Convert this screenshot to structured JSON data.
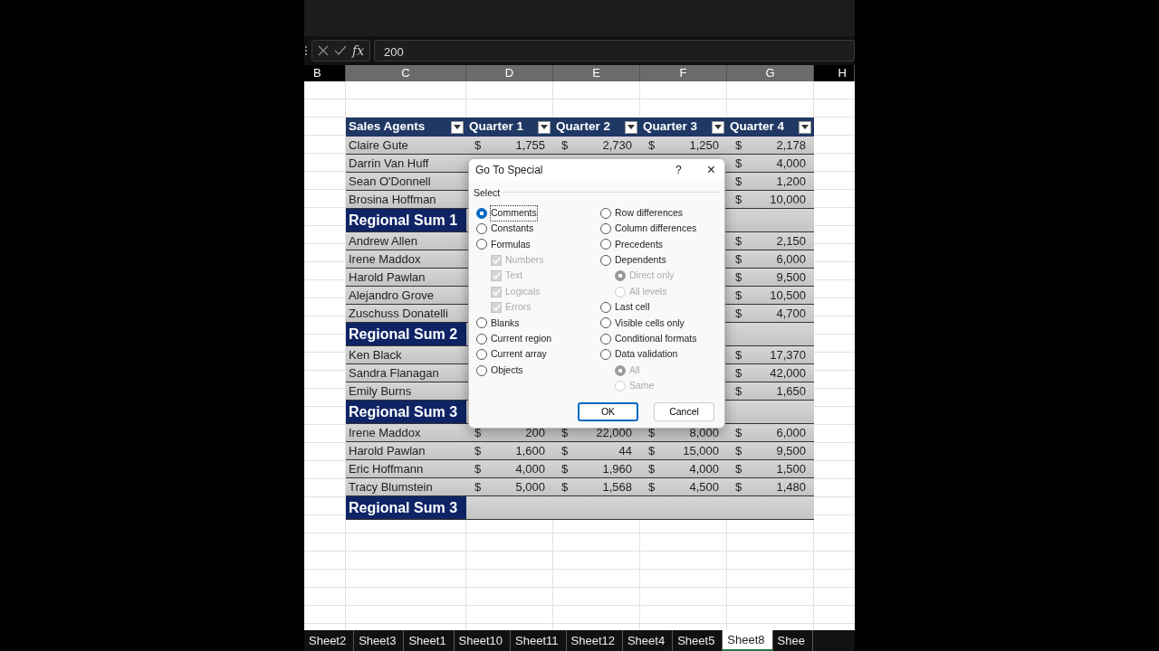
{
  "formula_bar": {
    "function_label": "fx",
    "value": "200"
  },
  "column_headers": [
    {
      "label": "B",
      "selected": false
    },
    {
      "label": "C",
      "selected": true
    },
    {
      "label": "D",
      "selected": true
    },
    {
      "label": "E",
      "selected": true
    },
    {
      "label": "F",
      "selected": true
    },
    {
      "label": "G",
      "selected": true
    },
    {
      "label": "H",
      "selected": false
    }
  ],
  "table": {
    "columns": [
      "Sales Agents",
      "Quarter 1",
      "Quarter 2",
      "Quarter 3",
      "Quarter 4"
    ],
    "rows": [
      {
        "kind": "data",
        "name": "Claire Gute",
        "values": [
          [
            "$",
            "1,755"
          ],
          [
            "$",
            "2,730"
          ],
          [
            "$",
            "1,250"
          ],
          [
            "$",
            "2,178"
          ]
        ]
      },
      {
        "kind": "data",
        "name": "Darrin Van Huff",
        "values": [
          [
            "$",
            "4,000"
          ]
        ]
      },
      {
        "kind": "data",
        "name": "Sean O'Donnell",
        "values": [
          [
            "$",
            "1,200"
          ]
        ]
      },
      {
        "kind": "data",
        "name": "Brosina Hoffman",
        "values": [
          [
            "$",
            "10,000"
          ]
        ]
      },
      {
        "kind": "sum",
        "name": "Regional Sum 1"
      },
      {
        "kind": "data",
        "name": "Andrew Allen",
        "values": [
          [
            "$",
            "2,150"
          ]
        ]
      },
      {
        "kind": "data",
        "name": "Irene Maddox",
        "values": [
          [
            "$",
            "6,000"
          ]
        ]
      },
      {
        "kind": "data",
        "name": "Harold Pawlan",
        "values": [
          [
            "$",
            "9,500"
          ]
        ]
      },
      {
        "kind": "data",
        "name": "Alejandro Grove",
        "values": [
          [
            "$",
            "10,500"
          ]
        ]
      },
      {
        "kind": "data",
        "name": "Zuschuss Donatelli",
        "values": [
          [
            "$",
            "4,700"
          ]
        ]
      },
      {
        "kind": "sum",
        "name": "Regional Sum 2"
      },
      {
        "kind": "data",
        "name": "Ken Black",
        "values": [
          [
            "$",
            "17,370"
          ]
        ]
      },
      {
        "kind": "data",
        "name": "Sandra Flanagan",
        "values": [
          [
            "$",
            "42,000"
          ]
        ]
      },
      {
        "kind": "data",
        "name": "Emily Burns",
        "values": [
          [
            "$",
            "1,650"
          ]
        ]
      },
      {
        "kind": "sum",
        "name": "Regional Sum 3"
      },
      {
        "kind": "data",
        "name": "Irene Maddox",
        "values": [
          [
            "$",
            "200"
          ],
          [
            "$",
            "22,000"
          ],
          [
            "$",
            "8,000"
          ],
          [
            "$",
            "6,000"
          ]
        ]
      },
      {
        "kind": "data",
        "name": "Harold Pawlan",
        "values": [
          [
            "$",
            "1,600"
          ],
          [
            "$",
            "44"
          ],
          [
            "$",
            "15,000"
          ],
          [
            "$",
            "9,500"
          ]
        ]
      },
      {
        "kind": "data",
        "name": "Eric Hoffmann",
        "values": [
          [
            "$",
            "4,000"
          ],
          [
            "$",
            "1,960"
          ],
          [
            "$",
            "4,000"
          ],
          [
            "$",
            "1,500"
          ]
        ]
      },
      {
        "kind": "data",
        "name": "Tracy Blumstein",
        "values": [
          [
            "$",
            "5,000"
          ],
          [
            "$",
            "1,568"
          ],
          [
            "$",
            "4,500"
          ],
          [
            "$",
            "1,480"
          ]
        ]
      },
      {
        "kind": "sum",
        "name": "Regional Sum 3"
      }
    ]
  },
  "dialog": {
    "title": "Go To Special",
    "help": "?",
    "close": "×",
    "group_label": "Select",
    "left_options": [
      {
        "kind": "radio",
        "label": "Comments",
        "selected": true,
        "disabled": false
      },
      {
        "kind": "radio",
        "label": "Constants",
        "selected": false,
        "disabled": false
      },
      {
        "kind": "radio",
        "label": "Formulas",
        "selected": false,
        "disabled": false,
        "children": [
          {
            "kind": "checkbox",
            "label": "Numbers",
            "checked": true,
            "disabled": true
          },
          {
            "kind": "checkbox",
            "label": "Text",
            "checked": true,
            "disabled": true
          },
          {
            "kind": "checkbox",
            "label": "Logicals",
            "checked": true,
            "disabled": true
          },
          {
            "kind": "checkbox",
            "label": "Errors",
            "checked": true,
            "disabled": true
          }
        ]
      },
      {
        "kind": "radio",
        "label": "Blanks",
        "selected": false,
        "disabled": false
      },
      {
        "kind": "radio",
        "label": "Current region",
        "selected": false,
        "disabled": false
      },
      {
        "kind": "radio",
        "label": "Current array",
        "selected": false,
        "disabled": false
      },
      {
        "kind": "radio",
        "label": "Objects",
        "selected": false,
        "disabled": false
      }
    ],
    "right_options": [
      {
        "kind": "radio",
        "label": "Row differences",
        "selected": false,
        "disabled": false
      },
      {
        "kind": "radio",
        "label": "Column differences",
        "selected": false,
        "disabled": false
      },
      {
        "kind": "radio",
        "label": "Precedents",
        "selected": false,
        "disabled": false
      },
      {
        "kind": "radio",
        "label": "Dependents",
        "selected": false,
        "disabled": false,
        "children": [
          {
            "kind": "radio",
            "label": "Direct only",
            "selected": true,
            "disabled": true
          },
          {
            "kind": "radio",
            "label": "All levels",
            "selected": false,
            "disabled": true
          }
        ]
      },
      {
        "kind": "radio",
        "label": "Last cell",
        "selected": false,
        "disabled": false
      },
      {
        "kind": "radio",
        "label": "Visible cells only",
        "selected": false,
        "disabled": false
      },
      {
        "kind": "radio",
        "label": "Conditional formats",
        "selected": false,
        "disabled": false
      },
      {
        "kind": "radio",
        "label": "Data validation",
        "selected": false,
        "disabled": false,
        "children": [
          {
            "kind": "radio",
            "label": "All",
            "selected": true,
            "disabled": true
          },
          {
            "kind": "radio",
            "label": "Same",
            "selected": false,
            "disabled": true
          }
        ]
      }
    ],
    "buttons": [
      {
        "label": "OK",
        "default": true
      },
      {
        "label": "Cancel",
        "default": false
      }
    ]
  },
  "sheet_tabs": [
    {
      "label": "Sheet2",
      "selected": false
    },
    {
      "label": "Sheet3",
      "selected": false
    },
    {
      "label": "Sheet1",
      "selected": false
    },
    {
      "label": "Sheet10",
      "selected": false
    },
    {
      "label": "Sheet11",
      "selected": false
    },
    {
      "label": "Sheet12",
      "selected": false
    },
    {
      "label": "Sheet4",
      "selected": false
    },
    {
      "label": "Sheet5",
      "selected": false
    },
    {
      "label": "Sheet8",
      "selected": true
    },
    {
      "label": "Shee",
      "selected": false
    }
  ]
}
